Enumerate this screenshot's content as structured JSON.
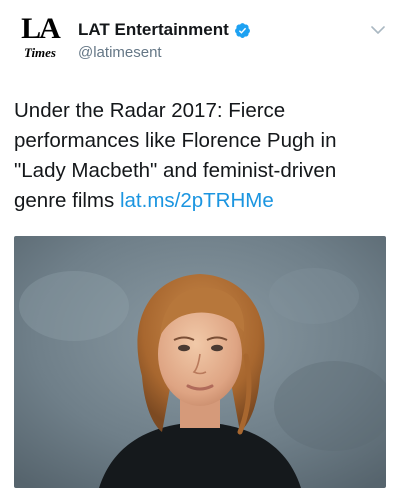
{
  "account": {
    "avatar_logo_top": "LA",
    "avatar_logo_bottom": "Times",
    "display_name": "LAT Entertainment",
    "handle": "@latimesent",
    "verified": true
  },
  "tweet": {
    "text": "Under the Radar 2017: Fierce performances like Florence Pugh in \"Lady Macbeth\" and feminist-driven genre films",
    "link": "lat.ms/2pTRHMe"
  },
  "colors": {
    "text": "#14171a",
    "secondary_text": "#657786",
    "link": "#1b95e0",
    "verified_badge": "#1da1f2"
  },
  "icons": {
    "verified": "verified-badge-icon",
    "menu": "chevron-down-icon"
  }
}
